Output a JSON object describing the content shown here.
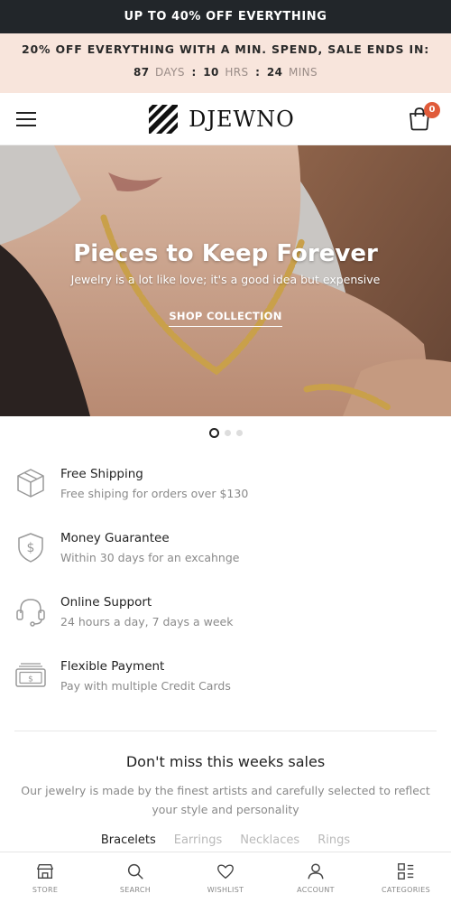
{
  "announcement": {
    "text": "UP TO 40% OFF EVERYTHING"
  },
  "promo": {
    "line": "20% OFF EVERYTHING WITH A MIN. SPEND, SALE ENDS IN:",
    "countdown": {
      "days_value": "87",
      "days_label": "DAYS",
      "hours_value": "10",
      "hours_label": "HRS",
      "mins_value": "24",
      "mins_label": "MINS",
      "separator": ":"
    }
  },
  "header": {
    "brand": "DJEWNO",
    "cart_count": "0",
    "menu_icon": "hamburger-icon",
    "cart_icon": "shopping-bag-icon"
  },
  "hero": {
    "title": "Pieces to Keep Forever",
    "subtitle": "Jewelry is a lot like love; it's a good idea but expensive",
    "cta": "SHOP COLLECTION",
    "slide_count": 3,
    "active_slide": 1
  },
  "features": [
    {
      "icon": "box-icon",
      "title": "Free Shipping",
      "desc": "Free shiping for orders over $130"
    },
    {
      "icon": "shield-dollar-icon",
      "title": "Money Guarantee",
      "desc": "Within 30 days for an excahnge"
    },
    {
      "icon": "headset-icon",
      "title": "Online Support",
      "desc": "24 hours a day, 7 days a week"
    },
    {
      "icon": "cash-icon",
      "title": "Flexible Payment",
      "desc": "Pay with multiple Credit Cards"
    }
  ],
  "sales": {
    "title": "Don't miss this weeks sales",
    "desc": "Our jewelry is made by the finest artists and carefully selected to reflect your style and personality",
    "tabs": [
      "Bracelets",
      "Earrings",
      "Necklaces",
      "Rings"
    ],
    "active_tab": "Bracelets"
  },
  "bottom_nav": [
    {
      "label": "STORE",
      "icon": "store-icon"
    },
    {
      "label": "SEARCH",
      "icon": "search-icon"
    },
    {
      "label": "WISHLIST",
      "icon": "heart-icon"
    },
    {
      "label": "ACCOUNT",
      "icon": "user-icon"
    },
    {
      "label": "CATEGORIES",
      "icon": "grid-icon"
    }
  ],
  "colors": {
    "topbar": "#22262a",
    "promo_bg": "#f8e5dc",
    "accent_badge": "#e05b3a"
  }
}
